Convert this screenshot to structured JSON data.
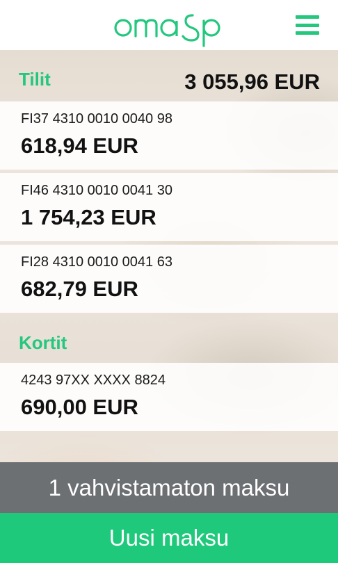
{
  "header": {
    "logo_text": "omasp",
    "menu_icon": "hamburger-menu-icon"
  },
  "accounts_section": {
    "title": "Tilit",
    "total": "3 055,96 EUR",
    "items": [
      {
        "number": "FI37 4310 0010 0040 98",
        "balance": "618,94 EUR"
      },
      {
        "number": "FI46 4310 0010 0041 30",
        "balance": "1 754,23 EUR"
      },
      {
        "number": "FI28 4310 0010 0041 63",
        "balance": "682,79 EUR"
      }
    ]
  },
  "cards_section": {
    "title": "Kortit",
    "items": [
      {
        "number": "4243 97XX XXXX 8824",
        "balance": "690,00 EUR"
      }
    ]
  },
  "footer": {
    "pending_label": "1 vahvistamaton maksu",
    "new_payment_label": "Uusi maksu"
  },
  "colors": {
    "brand_green": "#23c77d",
    "pending_gray": "#6d7073"
  }
}
